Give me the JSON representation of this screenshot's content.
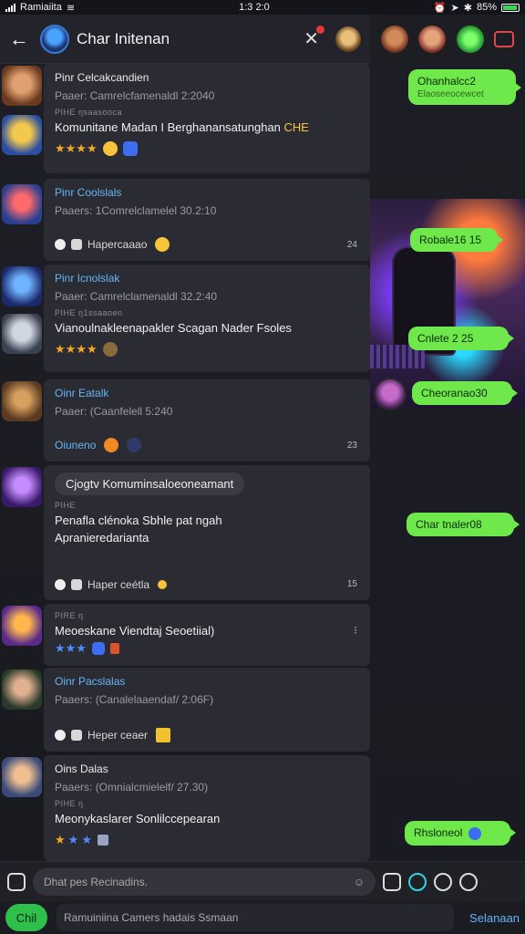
{
  "status": {
    "carrier": "Ramiaiita",
    "time": "1:3 2:0",
    "battery": "85%"
  },
  "header": {
    "title": "Char Initenan"
  },
  "feed": [
    {
      "name": "Pinr Celcakcandien",
      "meta": "Paaer: Camrelcfamenaldl 2:2040",
      "small": "PIHE  ŋsaasooca",
      "text_a": "Komunitane Madan I Berghanansatunghan ",
      "text_hl": "CHE",
      "stars": "★★★★"
    },
    {
      "name": "Pinr Coolslals",
      "meta": "Paaers: 1Comrelclamelel 30.2:10",
      "react_text": "Hapercaaao",
      "count": "24"
    },
    {
      "name": "Pinr Icnolslak",
      "meta": "Paaer: Camrelclamenaldl 32.2:40",
      "small": "PIHE  ŋ1ssaaoen",
      "text": "Vianoulnakleenapakler Scagan Nader Fsoles",
      "stars": "★★★★"
    },
    {
      "name": "Oinr Eatalk",
      "meta": "Paaer: (Caanfelell 5:240",
      "pill": "Oiuneno",
      "count": "23"
    },
    {
      "chip": "Cjogtv Komuminsaloeoneamant",
      "small": "PIHE",
      "text1": "Penafla clénoka Sbhle pat ngah",
      "text2": "Apranieredarianta",
      "react_text": "Haper ceétla",
      "count": "15"
    },
    {
      "small": "PIRE  ŋ",
      "text": "Meoeskane Viendtaj Seoetiial)",
      "more": "⁝"
    },
    {
      "name": "Oinr Pacslalas",
      "meta": "Paaers: (Canalelaaendaf/ 2:06F)",
      "react_text": "Heper ceaer",
      "count": ""
    },
    {
      "name": "Oins Dalas",
      "meta": "Paaers: (Omnialcmielelf/ 27.30)",
      "small": "PIHE  ŋ",
      "text": "Meonykaslarer Sonlilccepearan"
    }
  ],
  "bubbles": [
    {
      "text": "Ohanhalcc2",
      "sub": "Elaoseeocewcet"
    },
    {
      "text": "Robale16 15"
    },
    {
      "text": "Cnlete 2 25"
    },
    {
      "text": "Cheoranao30"
    },
    {
      "text": "Char tnaler08"
    },
    {
      "text": "Rhsloneol"
    }
  ],
  "input": {
    "placeholder": "Dhat pes Recinadins."
  },
  "bottom": {
    "chat_label": "Chil",
    "field": "Ramuiniina Camers hadais Ssmaan",
    "send": "Selanaan"
  }
}
